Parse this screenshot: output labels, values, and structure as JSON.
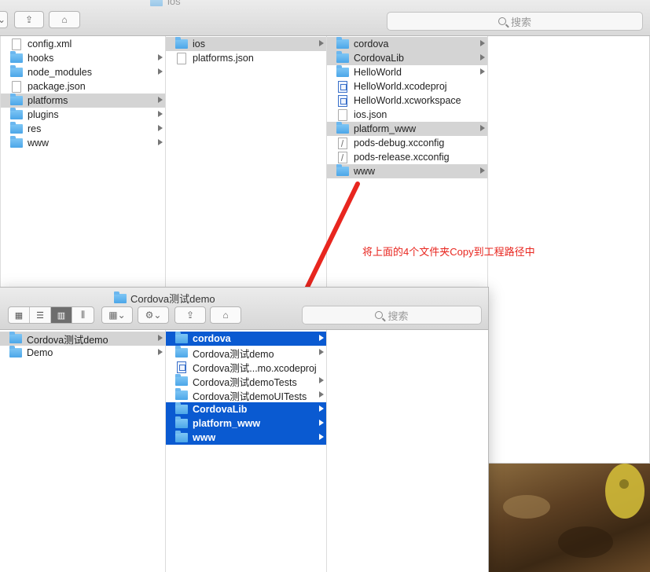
{
  "back_window": {
    "title": "ios",
    "search_placeholder": "搜索",
    "columns": [
      {
        "items": [
          {
            "label": "config.xml",
            "icon": "doc-icon",
            "arrow": false,
            "selected": false
          },
          {
            "label": "hooks",
            "icon": "folder-icon",
            "arrow": true,
            "selected": false
          },
          {
            "label": "node_modules",
            "icon": "folder-icon",
            "arrow": true,
            "selected": false
          },
          {
            "label": "package.json",
            "icon": "doc-icon",
            "arrow": false,
            "selected": false
          },
          {
            "label": "platforms",
            "icon": "folder-icon",
            "arrow": true,
            "selected": true
          },
          {
            "label": "plugins",
            "icon": "folder-icon",
            "arrow": true,
            "selected": false
          },
          {
            "label": "res",
            "icon": "folder-icon",
            "arrow": true,
            "selected": false
          },
          {
            "label": "www",
            "icon": "folder-icon",
            "arrow": true,
            "selected": false
          }
        ]
      },
      {
        "items": [
          {
            "label": "ios",
            "icon": "folder-icon",
            "arrow": true,
            "selected": true
          },
          {
            "label": "platforms.json",
            "icon": "doc-icon",
            "arrow": false,
            "selected": false
          }
        ]
      },
      {
        "items": [
          {
            "label": "cordova",
            "icon": "folder-icon",
            "arrow": true,
            "selected": true
          },
          {
            "label": "CordovaLib",
            "icon": "folder-icon",
            "arrow": true,
            "selected": true
          },
          {
            "label": "HelloWorld",
            "icon": "folder-icon",
            "arrow": true,
            "selected": false
          },
          {
            "label": "HelloWorld.xcodeproj",
            "icon": "xcode-icon",
            "arrow": false,
            "selected": false
          },
          {
            "label": "HelloWorld.xcworkspace",
            "icon": "xcode-icon",
            "arrow": false,
            "selected": false
          },
          {
            "label": "ios.json",
            "icon": "doc-icon",
            "arrow": false,
            "selected": false
          },
          {
            "label": "platform_www",
            "icon": "folder-icon",
            "arrow": true,
            "selected": true
          },
          {
            "label": "pods-debug.xcconfig",
            "icon": "config-icon",
            "arrow": false,
            "selected": false
          },
          {
            "label": "pods-release.xcconfig",
            "icon": "config-icon",
            "arrow": false,
            "selected": false
          },
          {
            "label": "www",
            "icon": "folder-icon",
            "arrow": true,
            "selected": true
          }
        ]
      }
    ]
  },
  "front_window": {
    "title": "Cordova测试demo",
    "search_placeholder": "搜索",
    "columns": [
      {
        "items": [
          {
            "label": "Cordova测试demo",
            "icon": "folder-icon",
            "arrow": true,
            "selected": "gray"
          },
          {
            "label": "Demo",
            "icon": "folder-icon",
            "arrow": true,
            "selected": ""
          }
        ]
      },
      {
        "items": [
          {
            "label": "cordova",
            "icon": "folder-icon",
            "arrow": true,
            "selected": "blue"
          },
          {
            "label": "Cordova测试demo",
            "icon": "folder-icon",
            "arrow": true,
            "selected": ""
          },
          {
            "label": "Cordova测试...mo.xcodeproj",
            "icon": "xcode-icon",
            "arrow": false,
            "selected": ""
          },
          {
            "label": "Cordova测试demoTests",
            "icon": "folder-icon",
            "arrow": true,
            "selected": ""
          },
          {
            "label": "Cordova测试demoUITests",
            "icon": "folder-icon",
            "arrow": true,
            "selected": ""
          },
          {
            "label": "CordovaLib",
            "icon": "folder-icon",
            "arrow": true,
            "selected": "blue"
          },
          {
            "label": "platform_www",
            "icon": "folder-icon",
            "arrow": true,
            "selected": "blue"
          },
          {
            "label": "www",
            "icon": "folder-icon",
            "arrow": true,
            "selected": "blue"
          }
        ]
      }
    ]
  },
  "annotation": {
    "text": "将上面的4个文件夹Copy到工程路径中",
    "color": "#e8261f"
  },
  "colors": {
    "selection_blue": "#0a5ad1",
    "selection_gray": "#d4d4d4",
    "folder_blue": "#4ca6e8"
  }
}
